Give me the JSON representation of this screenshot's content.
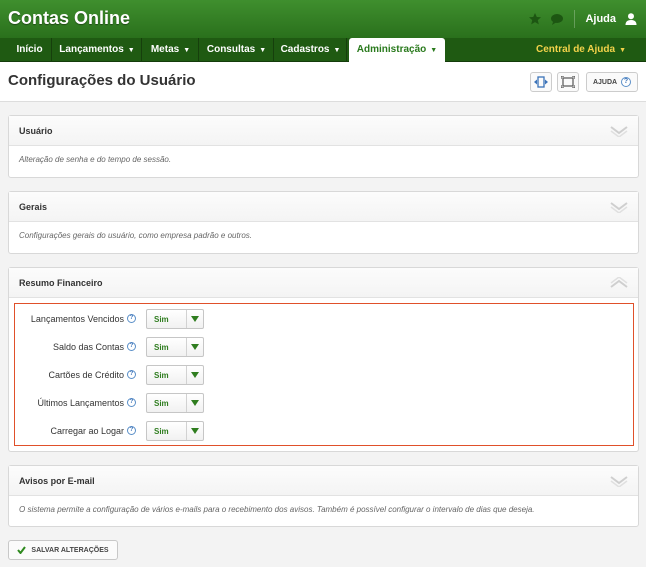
{
  "app": {
    "title": "Contas Online",
    "help_label": "Ajuda"
  },
  "nav": {
    "items": [
      {
        "label": "Início",
        "caret": ""
      },
      {
        "label": "Lançamentos",
        "caret": "▼"
      },
      {
        "label": "Metas",
        "caret": "▼"
      },
      {
        "label": "Consultas",
        "caret": "▼"
      },
      {
        "label": "Cadastros",
        "caret": "▼"
      },
      {
        "label": "Administração",
        "caret": "▼"
      }
    ],
    "active_index": 5,
    "help_center": "Central de Ajuda",
    "help_center_caret": "▼"
  },
  "page": {
    "title": "Configurações do Usuário",
    "help_button": "AJUDA"
  },
  "panels": {
    "usuario": {
      "title": "Usuário",
      "desc": "Alteração de senha e do tempo de sessão."
    },
    "gerais": {
      "title": "Gerais",
      "desc": "Configurações gerais do usuário, como empresa padrão e outros."
    },
    "resumo": {
      "title": "Resumo Financeiro",
      "rows": [
        {
          "label": "Lançamentos Vencidos",
          "value": "Sim"
        },
        {
          "label": "Saldo das Contas",
          "value": "Sim"
        },
        {
          "label": "Cartões de Crédito",
          "value": "Sim"
        },
        {
          "label": "Últimos Lançamentos",
          "value": "Sim"
        },
        {
          "label": "Carregar ao Logar",
          "value": "Sim"
        }
      ]
    },
    "avisos": {
      "title": "Avisos por E-mail",
      "desc": "O sistema permite a configuração de vários e-mails para o recebimento dos avisos. Também é possível configurar o intervalo de dias que deseja."
    }
  },
  "footer": {
    "save_label": "SALVAR ALTERAÇÕES"
  },
  "icons": {
    "star": "star-icon",
    "chat": "chat-icon",
    "user": "user-icon",
    "expand": "expand-icon",
    "fullscreen": "fullscreen-icon",
    "help": "question-icon",
    "check": "check-icon",
    "dropdown": "dropdown-arrow-icon"
  },
  "colors": {
    "brand_green": "#2a701c",
    "nav_dark": "#1f5a12",
    "highlight": "#e0502a",
    "help_center": "#f2d24a"
  },
  "qmark": "?"
}
